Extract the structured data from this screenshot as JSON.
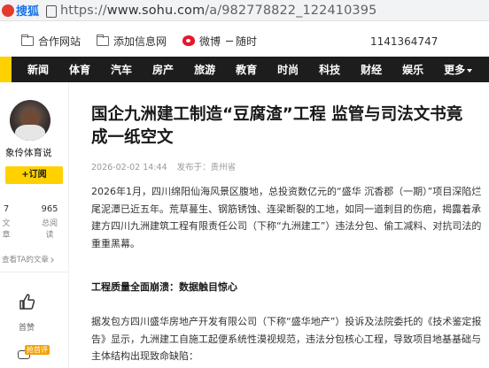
{
  "browser": {
    "brand_label": "搜狐",
    "url_prefix": "https://",
    "url_host": "www.sohu.com",
    "url_path": "/a/982778822_122410395"
  },
  "bookmarks": {
    "items": [
      "合作网站",
      "添加信息网",
      "微博"
    ],
    "cut_item": "随时",
    "right_text": "1141364747"
  },
  "nav": {
    "items": [
      "新闻",
      "体育",
      "汽车",
      "房产",
      "旅游",
      "教育",
      "时尚",
      "科技",
      "财经",
      "娱乐",
      "更多"
    ]
  },
  "author": {
    "name": "象伶体育说",
    "follow_label": "+订阅",
    "stats": [
      {
        "value": "7",
        "label": "文章"
      },
      {
        "value": "965",
        "label": "总阅读"
      }
    ],
    "see_all": "查看TA的文章",
    "like_label": "首赞",
    "comment_tag": "抢首评"
  },
  "article": {
    "title_line1": "国企九洲建工制造“豆腐渣”工程 监管与司法文书竟",
    "title_line2": "成一纸空文",
    "date": "2026-02-02 14:44",
    "source_prefix": "发布于：",
    "source_name": "贵州省",
    "p1": [
      "2026年1月，四川绵阳仙海风景区腹地，总投资数亿元的“盛华 沉香郡（一期）”项目深陷烂",
      "尾泥潭已近五年。荒草蔓生、钢筋锈蚀、连梁断裂的工地，如同一道刺目的伤疤，揭露着承",
      "建方四川九洲建筑工程有限责任公司（下称“九洲建工”）违法分包、偷工减料、对抗司法的",
      "重重黑幕。"
    ],
    "p2": "工程质量全面崩溃：数据触目惊心",
    "p3": [
      "据发包方四川盛华房地产开发有限公司（下称“盛华地产”）投诉及法院委托的《技术鉴定报",
      "告》显示，九洲建工自施工起便系统性漠视规范，违法分包核心工程，导致项目地基基础与",
      "主体结构出现致命缺陷："
    ]
  }
}
